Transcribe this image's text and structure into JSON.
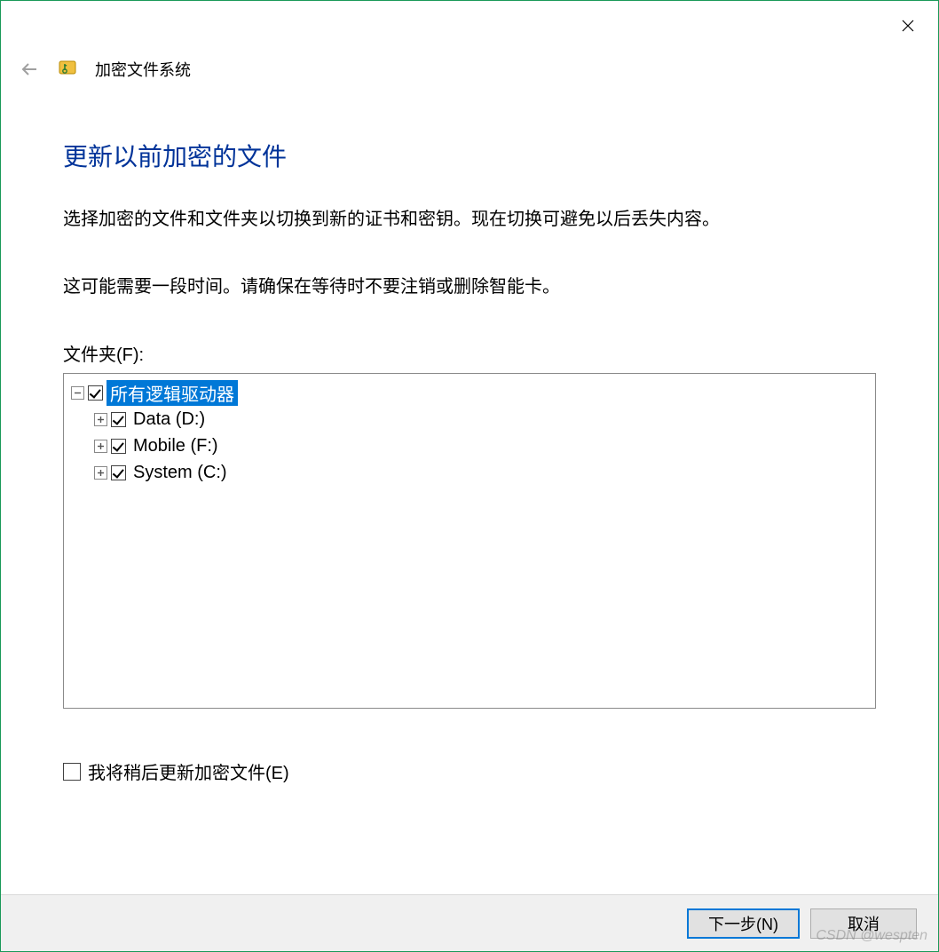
{
  "window": {
    "app_title": "加密文件系统"
  },
  "page": {
    "heading": "更新以前加密的文件",
    "desc1": "选择加密的文件和文件夹以切换到新的证书和密钥。现在切换可避免以后丢失内容。",
    "desc2": "这可能需要一段时间。请确保在等待时不要注销或删除智能卡。",
    "folders_label": "文件夹(F):",
    "later_label": "我将稍后更新加密文件(E)"
  },
  "tree": {
    "root": {
      "label": "所有逻辑驱动器",
      "expanded": true,
      "checked": true,
      "selected": true
    },
    "children": [
      {
        "label": "Data (D:)",
        "expanded": false,
        "checked": true
      },
      {
        "label": "Mobile (F:)",
        "expanded": false,
        "checked": true
      },
      {
        "label": "System (C:)",
        "expanded": false,
        "checked": true
      }
    ]
  },
  "footer": {
    "next": "下一步(N)",
    "cancel": "取消"
  },
  "watermark": "CSDN @wespten"
}
